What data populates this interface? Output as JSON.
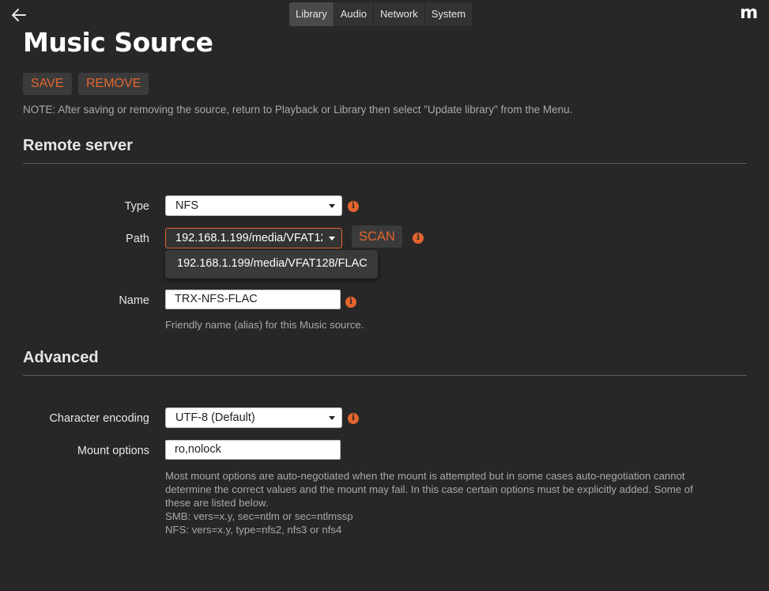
{
  "header": {
    "tabs": [
      {
        "label": "Library",
        "active": true
      },
      {
        "label": "Audio",
        "active": false
      },
      {
        "label": "Network",
        "active": false
      },
      {
        "label": "System",
        "active": false
      }
    ],
    "brand": "m"
  },
  "page": {
    "title": "Music Source",
    "save_label": "SAVE",
    "remove_label": "REMOVE",
    "note": "NOTE: After saving or removing the source, return to Playback or Library then select \"Update library\" from the Menu."
  },
  "remote_server": {
    "heading": "Remote server",
    "type_label": "Type",
    "type_value": "NFS",
    "path_label": "Path",
    "path_value": "192.168.1.199/media/VFAT128/FLAC",
    "scan_label": "SCAN",
    "path_options": [
      "192.168.1.199/media/VFAT128/FLAC"
    ],
    "name_label": "Name",
    "name_value": "TRX-NFS-FLAC",
    "name_help": "Friendly name (alias) for this Music source."
  },
  "advanced": {
    "heading": "Advanced",
    "encoding_label": "Character encoding",
    "encoding_value": "UTF-8 (Default)",
    "mount_label": "Mount options",
    "mount_value": "ro,nolock",
    "mount_help": [
      "Most mount options are auto-negotiated when the mount is attempted but in some cases auto-negotiation cannot",
      "determine the correct values and the mount may fail. In this case certain options must be explicitly added. Some of",
      "these are listed below.",
      "SMB: vers=x.y, sec=ntlm or sec=ntlmssp",
      "NFS: vers=x.y, type=nfs2, nfs3 or nfs4"
    ]
  },
  "icons": {
    "back": "arrow-left-icon",
    "info": "info-icon",
    "caret": "chevron-down-icon"
  },
  "colors": {
    "background": "#272727",
    "accent": "#e3652d",
    "panel": "#3b3b3b",
    "text": "#e6e6e6",
    "muted": "#a9a9a9"
  }
}
